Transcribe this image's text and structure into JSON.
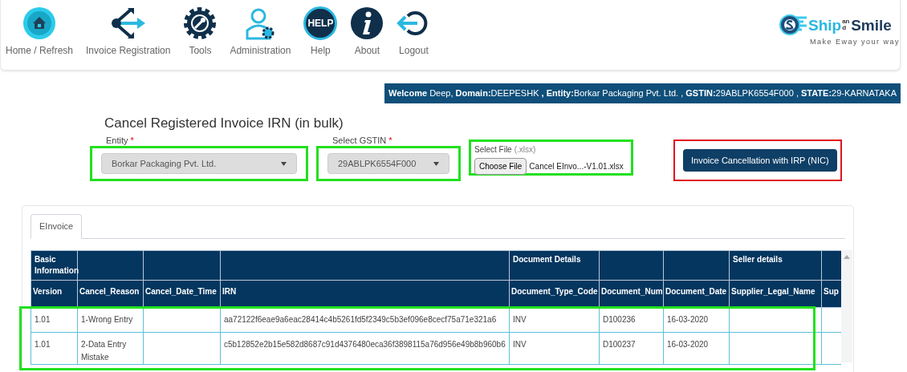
{
  "nav": {
    "items": [
      {
        "label": "Home / Refresh"
      },
      {
        "label": "Invoice Registration"
      },
      {
        "label": "Tools"
      },
      {
        "label": "Administration"
      },
      {
        "label": "Help",
        "icon_text": "HELP"
      },
      {
        "label": "About"
      },
      {
        "label": "Logout"
      }
    ]
  },
  "logo": {
    "brand_first": "Ship",
    "brand_small": "and",
    "brand_second": "Smile",
    "tagline": "Make Eway your way"
  },
  "welcome": "**Welcome** Deep,  **Domain:**DEEPESHK **,** **Entity:**Borkar Packaging Pvt. Ltd. , **GSTIN:**29ABLPK6554F000 , **STATE:**29-KARNATAKA",
  "form": {
    "title": "Cancel Registered Invoice IRN (in bulk)",
    "controls": [
      {
        "kind": "select",
        "label": "Entity",
        "required_mark": "*",
        "value": "Borkar Packaging Pvt. Ltd.",
        "color": "#22e01f"
      },
      {
        "kind": "select",
        "label": "Select GSTIN",
        "required_mark": "*",
        "value": "29ABLPK6554F000",
        "color": "#22e01f"
      },
      {
        "kind": "file",
        "label": "Select File",
        "hint": "(.xlsx)",
        "button": "Choose File",
        "filename": "Cancel EInvo...-V1.01.xlsx",
        "color": "#22e01f"
      },
      {
        "kind": "button",
        "label": "Invoice Cancellation with IRP (NIC)",
        "color": "#e0141e"
      }
    ]
  },
  "tabs": [
    {
      "label": "EInvoice",
      "selected": true
    }
  ],
  "table": {
    "columns": [
      {
        "label": "Version",
        "group": "Basic Information"
      },
      {
        "label": "Cancel_Reason"
      },
      {
        "label": "Cancel_Date_Time"
      },
      {
        "label": "IRN"
      },
      {
        "label": "Document_Type_Code",
        "group": "Document Details"
      },
      {
        "label": "Document_Num"
      },
      {
        "label": "Document_Date"
      },
      {
        "label": "Supplier_Legal_Name",
        "group": "Seller details"
      },
      {
        "label": "Sup"
      }
    ],
    "row_highlight": {
      "color": "#22e01f"
    },
    "rows": [
      [
        "1.01",
        "1-Wrong Entry",
        "",
        "aa72122f6eae9a6eac28414c4b5261fd5f2349c5b3ef096e8cecf75a71e321a6",
        "INV",
        "D100236",
        "16-03-2020",
        "",
        ""
      ],
      [
        "1.01",
        "2-Data Entry Mistake",
        "",
        "c5b12852e2b15e582d8687c91d4376480eca36f3898115a76d956e49b8b960b6",
        "INV",
        "D100237",
        "16-03-2020",
        "",
        ""
      ]
    ]
  }
}
